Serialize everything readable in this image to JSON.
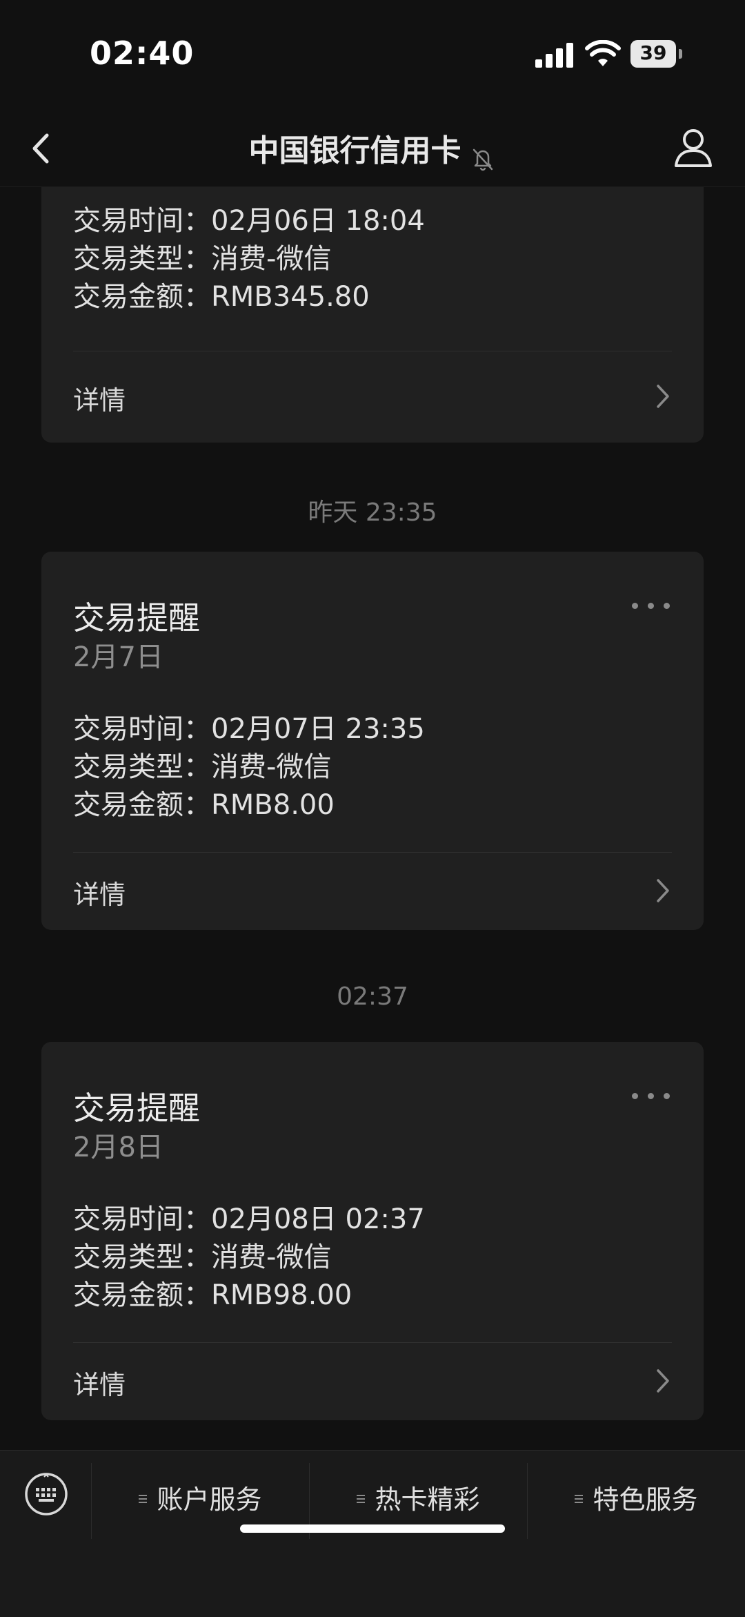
{
  "status_bar": {
    "time": "02:40",
    "battery": "39"
  },
  "nav": {
    "title": "中国银行信用卡"
  },
  "cards": [
    {
      "rows": [
        {
          "label": "交易时间：",
          "value": "02月06日 18:04"
        },
        {
          "label": "交易类型：",
          "value": "消费-微信"
        },
        {
          "label": "交易金额：",
          "value": "RMB345.80"
        }
      ],
      "detail_label": "详情"
    },
    {
      "timestamp": "昨天 23:35",
      "title": "交易提醒",
      "date": "2月7日",
      "rows": [
        {
          "label": "交易时间：",
          "value": "02月07日 23:35"
        },
        {
          "label": "交易类型：",
          "value": "消费-微信"
        },
        {
          "label": "交易金额：",
          "value": "RMB8.00"
        }
      ],
      "detail_label": "详情"
    },
    {
      "timestamp": "02:37",
      "title": "交易提醒",
      "date": "2月8日",
      "rows": [
        {
          "label": "交易时间：",
          "value": "02月08日 02:37"
        },
        {
          "label": "交易类型：",
          "value": "消费-微信"
        },
        {
          "label": "交易金额：",
          "value": "RMB98.00"
        }
      ],
      "detail_label": "详情"
    }
  ],
  "bottom_menu": {
    "items": [
      {
        "label": "账户服务"
      },
      {
        "label": "热卡精彩"
      },
      {
        "label": "特色服务"
      }
    ]
  },
  "icons": {
    "back": "chevron-left-icon",
    "mute": "bell-slash-icon",
    "profile": "person-icon",
    "more": "ellipsis-icon",
    "keyboard": "keyboard-icon",
    "detail": "chevron-right-icon"
  }
}
